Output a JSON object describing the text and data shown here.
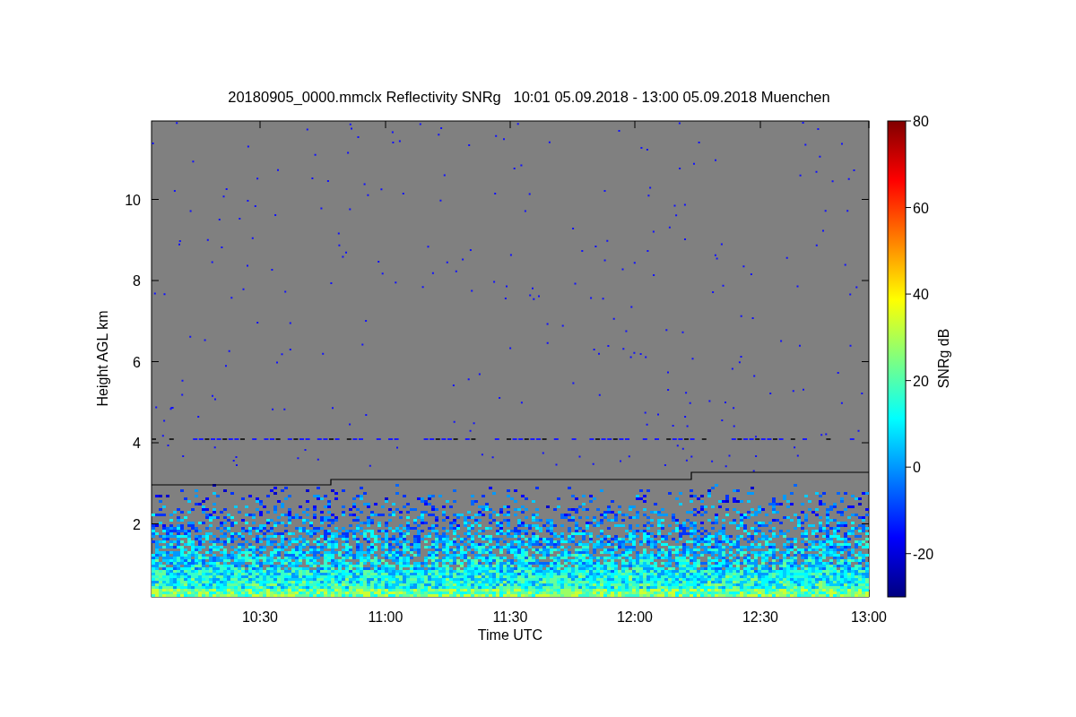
{
  "title": "20180905_0000.mmclx Reflectivity SNRg   10:01 05.09.2018 - 13:00 05.09.2018 Muenchen",
  "y_axis": {
    "label": "Height AGL km",
    "ticks": [
      "10",
      "8",
      "6",
      "4",
      "2"
    ]
  },
  "x_axis": {
    "label": "Time UTC",
    "ticks": [
      "10:30",
      "11:00",
      "11:30",
      "12:00",
      "12:30",
      "13:00"
    ]
  },
  "colorbar": {
    "label": "SNRg dB",
    "ticks": [
      "80",
      "60",
      "40",
      "20",
      "0",
      "-20"
    ]
  }
}
